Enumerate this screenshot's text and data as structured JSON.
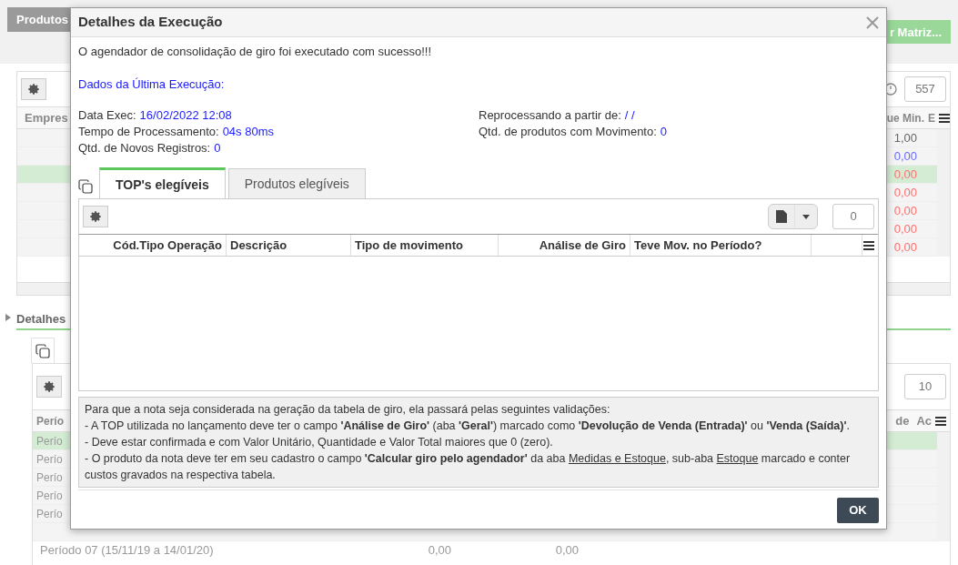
{
  "background": {
    "top_tab": "Produtos",
    "matrix_button": "r Matriz...",
    "upper_panel": {
      "count": "557",
      "columns": [
        "Empres",
        "ue Min.",
        "E"
      ],
      "rows": [
        {
          "value": "1,00",
          "color": "#666666",
          "selected": false
        },
        {
          "value": "0,00",
          "color": "#6b6bff",
          "selected": false
        },
        {
          "value": "0,00",
          "color": "#ff7070",
          "selected": true
        },
        {
          "value": "0,00",
          "color": "#ff7070",
          "selected": false
        },
        {
          "value": "0,00",
          "color": "#ff7070",
          "selected": false
        },
        {
          "value": "0,00",
          "color": "#ff7070",
          "selected": false
        },
        {
          "value": "0,00",
          "color": "#ff7070",
          "selected": false
        }
      ]
    },
    "lower_panel": {
      "title": "Detalhes",
      "count": "10",
      "columns": [
        "Perío",
        "de",
        "Ac"
      ],
      "rows": [
        {
          "label": "Perío",
          "selected": true
        },
        {
          "label": "Perío",
          "selected": false
        },
        {
          "label": "Perío",
          "selected": false
        },
        {
          "label": "Perío",
          "selected": false
        },
        {
          "label": "Perío",
          "selected": false
        }
      ],
      "last_row": {
        "label": "Período 07 (15/11/19 a 14/01/20)",
        "values": [
          "0,00",
          "0,00"
        ]
      }
    }
  },
  "modal": {
    "title": "Detalhes da Execução",
    "message": "O agendador de consolidação de giro foi executado com sucesso!!!",
    "section_title": "Dados da Última Execução:",
    "left_fields": [
      {
        "label": "Data Exec:",
        "value": "16/02/2022 12:08"
      },
      {
        "label": "Tempo de Processamento:",
        "value": "04s 80ms"
      },
      {
        "label": "Qtd. de Novos Registros:",
        "value": "0"
      }
    ],
    "right_fields": [
      {
        "label": "Reprocessando a partir de:",
        "value": "/ /"
      },
      {
        "label": "Qtd. de produtos com Movimento:",
        "value": "0"
      }
    ],
    "tabs": [
      {
        "label": "TOP's elegíveis",
        "selected": true
      },
      {
        "label": "Produtos elegíveis",
        "selected": false
      }
    ],
    "grid": {
      "count": "0",
      "columns": [
        "Cód.Tipo Operação",
        "Descrição",
        "Tipo de movimento",
        "Análise de Giro",
        "Teve Mov. no Período?"
      ]
    },
    "notes": [
      [
        {
          "kind": "text",
          "text": "Para que a nota seja considerada na geração da tabela de giro, ela passará pelas seguintes validações:"
        }
      ],
      [
        {
          "kind": "text",
          "text": "- A TOP utilizada no lançamento deve ter o campo **'Análise de Giro'** (aba **'Geral'**) marcado como **'Devolução de Venda (Entrada)'** ou **'Venda (Saída)'**."
        }
      ],
      [
        {
          "kind": "text",
          "text": "- Deve estar confirmada e com Valor Unitário, Quantidade e Valor Total maiores que 0 (zero)."
        }
      ],
      [
        {
          "kind": "text",
          "text": "- O produto da nota deve ter em seu cadastro o campo **'Calcular giro pelo agendador'** da aba "
        },
        {
          "kind": "link",
          "text": "Medidas e Estoque"
        },
        {
          "kind": "text",
          "text": ", sub-aba "
        },
        {
          "kind": "link",
          "text": "Estoque"
        },
        {
          "kind": "text",
          "text": " marcado e conter custos gravados na respectiva tabela."
        }
      ]
    ],
    "ok_button": "OK"
  }
}
